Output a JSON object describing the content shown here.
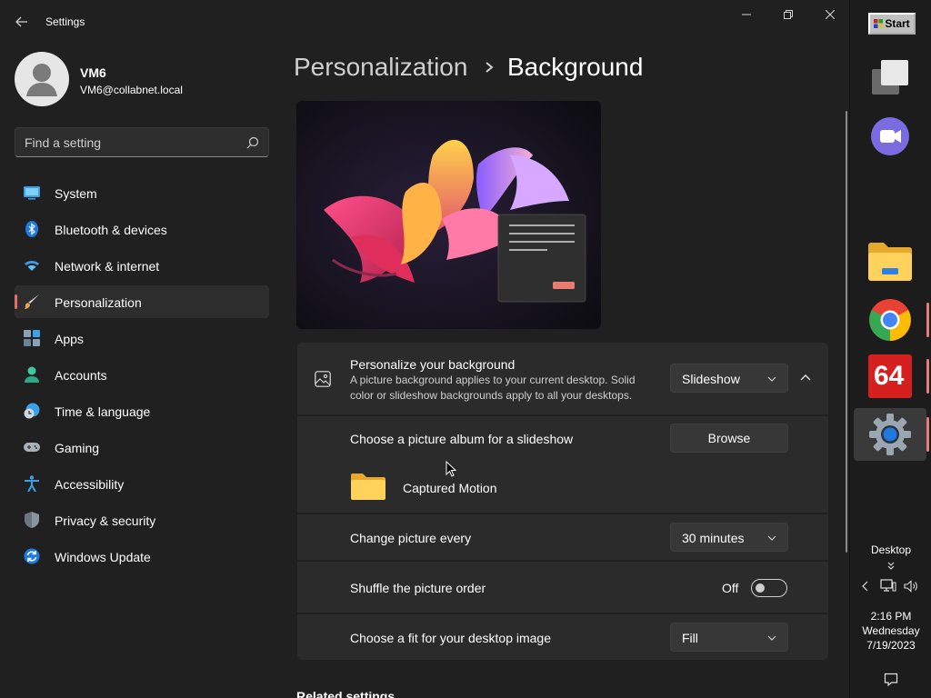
{
  "window": {
    "title": "Settings"
  },
  "profile": {
    "name": "VM6",
    "email": "VM6@collabnet.local"
  },
  "search": {
    "placeholder": "Find a setting"
  },
  "nav": {
    "items": [
      {
        "label": "System",
        "icon": "system-icon"
      },
      {
        "label": "Bluetooth & devices",
        "icon": "bluetooth-icon"
      },
      {
        "label": "Network & internet",
        "icon": "wifi-icon"
      },
      {
        "label": "Personalization",
        "icon": "brush-icon",
        "active": true
      },
      {
        "label": "Apps",
        "icon": "apps-icon"
      },
      {
        "label": "Accounts",
        "icon": "accounts-icon"
      },
      {
        "label": "Time & language",
        "icon": "time-language-icon"
      },
      {
        "label": "Gaming",
        "icon": "gamepad-icon"
      },
      {
        "label": "Accessibility",
        "icon": "accessibility-icon"
      },
      {
        "label": "Privacy & security",
        "icon": "shield-icon"
      },
      {
        "label": "Windows Update",
        "icon": "update-icon"
      }
    ]
  },
  "breadcrumb": {
    "parent": "Personalization",
    "current": "Background"
  },
  "background": {
    "title": "Personalize your background",
    "description": "A picture background applies to your current desktop. Solid color or slideshow backgrounds apply to all your desktops.",
    "type_value": "Slideshow",
    "album_label": "Choose a picture album for a slideshow",
    "browse_label": "Browse",
    "album_name": "Captured Motion",
    "change_label": "Change picture every",
    "change_value": "30 minutes",
    "shuffle_label": "Shuffle the picture order",
    "shuffle_state": "Off",
    "fit_label": "Choose a fit for your desktop image",
    "fit_value": "Fill"
  },
  "related": {
    "heading": "Related settings"
  },
  "taskbar": {
    "start_label": "Start",
    "apps": [
      {
        "name": "task-view"
      },
      {
        "name": "teams-chat"
      },
      {
        "name": "file-explorer"
      },
      {
        "name": "chrome"
      },
      {
        "name": "aida64",
        "text": "64"
      },
      {
        "name": "settings"
      }
    ],
    "desktop_label": "Desktop",
    "time": "2:16 PM",
    "day": "Wednesday",
    "date": "7/19/2023"
  },
  "colors": {
    "accent": "#e66b6b",
    "background": "#202020",
    "card": "#2b2b2b"
  }
}
